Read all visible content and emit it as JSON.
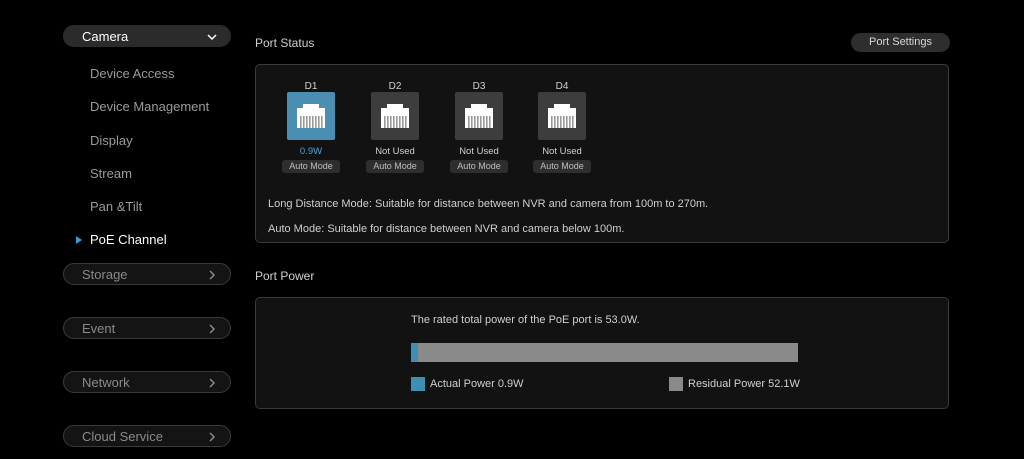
{
  "sidebar": {
    "categories": [
      {
        "label": "Camera"
      },
      {
        "label": "Storage"
      },
      {
        "label": "Event"
      },
      {
        "label": "Network"
      },
      {
        "label": "Cloud Service"
      }
    ],
    "camera_items": [
      {
        "label": "Device Access"
      },
      {
        "label": "Device Management"
      },
      {
        "label": "Display"
      },
      {
        "label": "Stream"
      },
      {
        "label": "Pan &Tilt"
      },
      {
        "label": "PoE Channel"
      }
    ],
    "selected_item": "PoE Channel"
  },
  "port_status": {
    "title": "Port Status",
    "settings_button": "Port Settings",
    "ports": [
      {
        "name": "D1",
        "status": "0.9W",
        "mode": "Auto Mode",
        "active": true
      },
      {
        "name": "D2",
        "status": "Not Used",
        "mode": "Auto Mode",
        "active": false
      },
      {
        "name": "D3",
        "status": "Not Used",
        "mode": "Auto Mode",
        "active": false
      },
      {
        "name": "D4",
        "status": "Not Used",
        "mode": "Auto Mode",
        "active": false
      }
    ],
    "long_distance_desc": "Long Distance Mode: Suitable for distance between NVR and camera from 100m to 270m.",
    "auto_mode_desc": "Auto Mode: Suitable for distance between NVR and camera below 100m."
  },
  "port_power": {
    "title": "Port Power",
    "rated_text": "The rated total power of the PoE port is 53.0W.",
    "actual_fraction": 0.017,
    "actual_label": "Actual Power 0.9W",
    "residual_label": "Residual Power 52.1W",
    "actual_color": "#3d8fb4",
    "residual_color": "#8a8a8a"
  },
  "colors": {
    "accent": "#4aa6d3",
    "port_active_bg": "#4a8fb2",
    "port_inactive_bg": "#3d3d3d"
  }
}
